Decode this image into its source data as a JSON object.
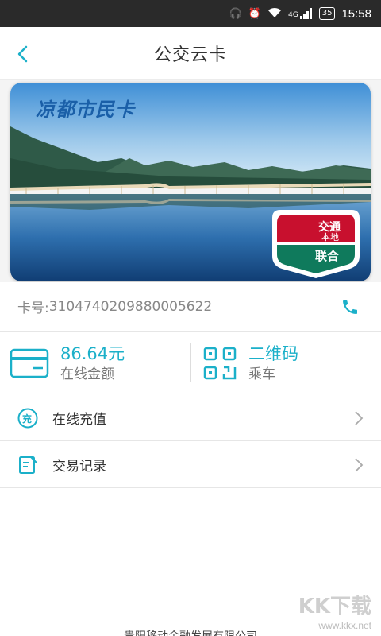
{
  "statusbar": {
    "signal": "4G",
    "battery": "35",
    "time": "15:58"
  },
  "appbar": {
    "title": "公交云卡"
  },
  "card": {
    "name": "凉都市民卡",
    "badge_top": "交通",
    "badge_local": "本地",
    "badge_union": "联合"
  },
  "cardno": {
    "label": "卡号:",
    "value": "3104740209880005622"
  },
  "info": {
    "balance_value": "86.64元",
    "balance_label": "在线金额",
    "qr_label": "二维码",
    "qr_sub": "乘车"
  },
  "menu": [
    {
      "label": "在线充值",
      "icon_char": "充"
    },
    {
      "label": "交易记录"
    }
  ],
  "footer": {
    "text": "贵阳移动金融发展有限公司"
  },
  "watermark": {
    "logo": "KK下载",
    "url": "www.kkx.net"
  },
  "colors": {
    "accent": "#1bb0c9",
    "statusbar": "#2a2a2a",
    "card_title": "#1a5fa8",
    "badge_red": "#c8102e",
    "badge_green": "#0f7a5c"
  }
}
